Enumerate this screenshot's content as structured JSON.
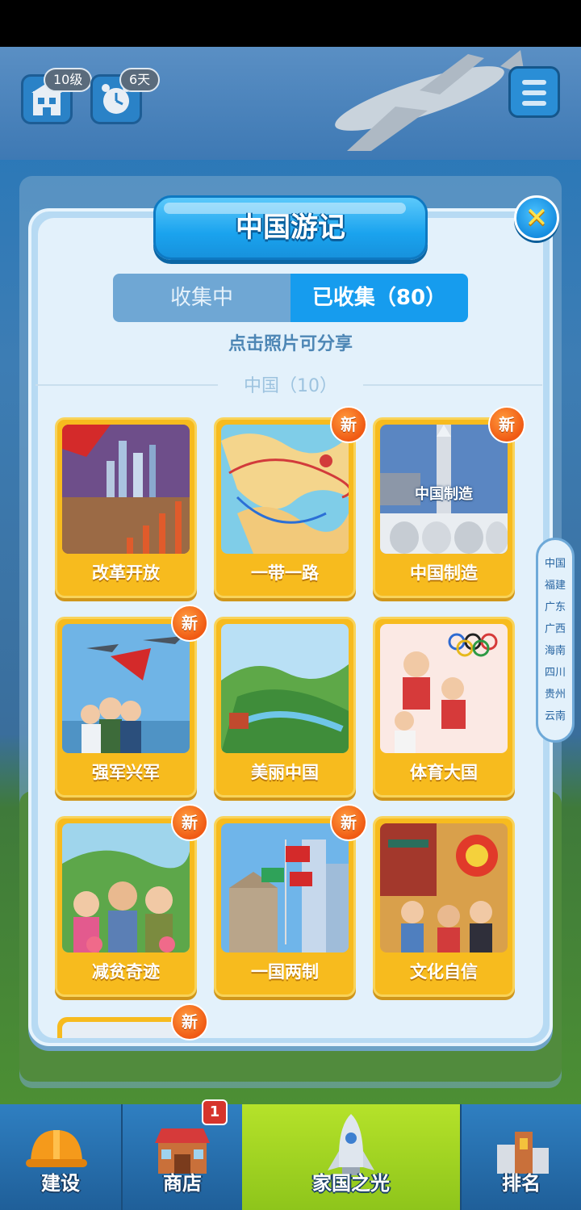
{
  "hud": {
    "level_badge": "10级",
    "days_badge": "6天"
  },
  "dialog": {
    "title": "中国游记",
    "close_icon": "close-x-icon",
    "tabs": [
      {
        "label": "收集中",
        "active": false
      },
      {
        "label": "已收集（80）",
        "active": true
      }
    ],
    "hint": "点击照片可分享",
    "section_title": "中国（10）",
    "new_badge": "新",
    "cards": [
      {
        "label": "改革开放",
        "is_new": false,
        "icon": "reform-opening-photo"
      },
      {
        "label": "一带一路",
        "is_new": true,
        "icon": "belt-and-road-map-photo"
      },
      {
        "label": "中国制造",
        "is_new": true,
        "icon": "made-in-china-photo",
        "overlay_text": "中国制造"
      },
      {
        "label": "强军兴军",
        "is_new": true,
        "icon": "military-photo"
      },
      {
        "label": "美丽中国",
        "is_new": false,
        "icon": "beautiful-china-photo"
      },
      {
        "label": "体育大国",
        "is_new": false,
        "icon": "sports-power-photo"
      },
      {
        "label": "减贫奇迹",
        "is_new": true,
        "icon": "poverty-reduction-photo"
      },
      {
        "label": "一国两制",
        "is_new": true,
        "icon": "one-country-two-systems-photo"
      },
      {
        "label": "文化自信",
        "is_new": false,
        "icon": "cultural-confidence-photo"
      },
      {
        "label": "",
        "is_new": true,
        "icon": "partial-photo"
      }
    ]
  },
  "index": [
    "中国",
    "福建",
    "广东",
    "广西",
    "海南",
    "四川",
    "贵州",
    "云南"
  ],
  "bottom_nav": {
    "items": [
      {
        "label": "建设",
        "icon": "hard-hat-icon",
        "active": false
      },
      {
        "label": "商店",
        "icon": "shop-icon",
        "active": false,
        "badge": "1"
      },
      {
        "label": "家国之光",
        "icon": "rocket-icon",
        "active": true
      },
      {
        "label": "排名",
        "icon": "ranking-building-icon",
        "active": false
      }
    ]
  },
  "colors": {
    "accent_blue": "#169cee",
    "card_gold": "#f7bb1e",
    "new_orange": "#f05a14",
    "nav_active": "#a6d523"
  }
}
